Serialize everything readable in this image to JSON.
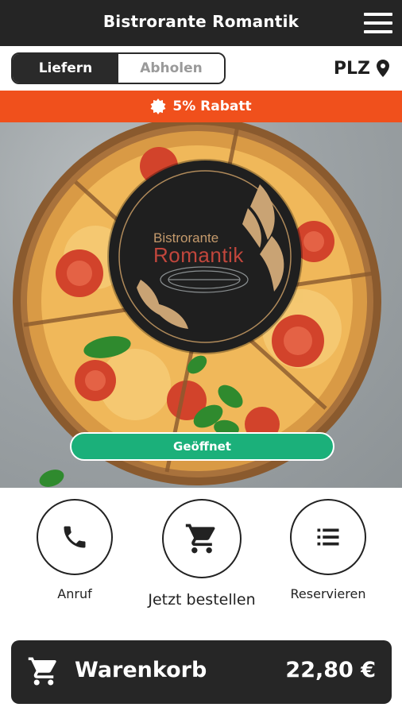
{
  "header": {
    "title": "Bistrorante Romantik",
    "menu_icon": "hamburger-menu-icon"
  },
  "order_mode": {
    "options": [
      {
        "label": "Liefern",
        "selected": true
      },
      {
        "label": "Abholen",
        "selected": false
      }
    ],
    "plz_label": "PLZ",
    "plz_icon": "location-pin-icon"
  },
  "promo": {
    "text": "5% Rabatt",
    "icon": "badge-icon",
    "color": "#f0501c"
  },
  "hero": {
    "logo_line1": "Bistrorante",
    "logo_line2": "Romantik",
    "status_text": "Geöffnet",
    "status_color": "#1bb07a"
  },
  "actions": [
    {
      "label": "Anruf",
      "icon": "phone-icon"
    },
    {
      "label": "Jetzt bestellen",
      "icon": "cart-icon"
    },
    {
      "label": "Reservieren",
      "icon": "list-icon"
    }
  ],
  "cart": {
    "label": "Warenkorb",
    "total": "22,80 €",
    "icon": "cart-icon"
  }
}
